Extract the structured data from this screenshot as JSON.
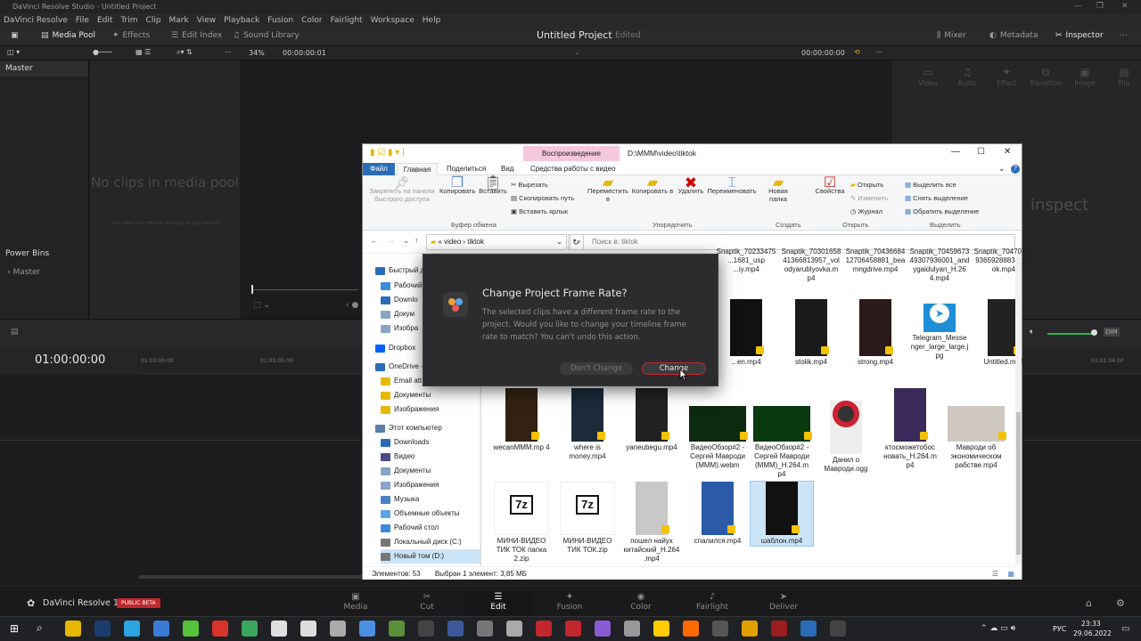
{
  "app": {
    "window_title": "DaVinci Resolve Studio - Untitled Project",
    "menu": [
      "DaVinci Resolve",
      "File",
      "Edit",
      "Trim",
      "Clip",
      "Mark",
      "View",
      "Playback",
      "Fusion",
      "Color",
      "Fairlight",
      "Workspace",
      "Help"
    ],
    "toolbar": {
      "media_pool": "Media Pool",
      "effects": "Effects",
      "edit_index": "Edit Index",
      "sound_library": "Sound Library",
      "project_title": "Untitled Project",
      "project_state": "Edited",
      "mixer": "Mixer",
      "metadata": "Metadata",
      "inspector": "Inspector"
    },
    "subbar": {
      "zoom": "34%",
      "timecode_left": "00:00:00:01",
      "timecode_right": "00:00:00:00"
    },
    "left_panel": {
      "master": "Master",
      "power_bins": "Power Bins",
      "power_master": "Master"
    },
    "media_pool": {
      "empty_text": "No clips in media pool",
      "hint": "Add clips from Media Storage to get started"
    },
    "inspector_panel": {
      "tabs": [
        "Video",
        "Audio",
        "Effect",
        "Transition",
        "Image",
        "File"
      ],
      "placeholder": "inspect"
    },
    "timeline": {
      "timecode": "01:00:00:00",
      "ruler": [
        "01:00:00:00",
        "01:00:05:00",
        "01:01:04:00"
      ]
    },
    "pages": [
      "Media",
      "Cut",
      "Edit",
      "Fusion",
      "Color",
      "Fairlight",
      "Deliver"
    ],
    "active_page": "Edit",
    "brand": "DaVinci Resolve 18",
    "beta_badge": "PUBLIC BETA"
  },
  "explorer": {
    "ribbon_context_tab": "Воспроизведение",
    "path_title": "D:\\MMM\\video\\tiktok",
    "tabs": [
      "Файл",
      "Главная",
      "Поделиться",
      "Вид",
      "Средства работы с видео"
    ],
    "ribbon": {
      "pin": "Закрепить на панели быстрого доступа",
      "copy": "Копировать",
      "paste": "Вставить",
      "cut": "Вырезать",
      "copy_path": "Скопировать путь",
      "paste_shortcut": "Вставить ярлык",
      "group_clipboard": "Буфер обмена",
      "move_to": "Переместить в",
      "copy_to": "Копировать в",
      "delete": "Удалить",
      "rename": "Переименовать",
      "group_organize": "Упорядочить",
      "new_folder": "Новая папка",
      "group_create": "Создать",
      "properties": "Свойства",
      "open": "Открыть",
      "edit": "Изменить",
      "history": "Журнал",
      "group_open": "Открыть",
      "select_all": "Выделить все",
      "select_none": "Снять выделение",
      "invert": "Обратить выделение",
      "group_select": "Выделить"
    },
    "address": {
      "parent": "«",
      "crumb1": "video",
      "crumb2": "tiktok",
      "search_placeholder": "Поиск в: tiktok"
    },
    "nav": [
      {
        "label": "Быстрый д",
        "icon": "star"
      },
      {
        "label": "Рабочий",
        "icon": "desktop"
      },
      {
        "label": "Downlo",
        "icon": "download"
      },
      {
        "label": "Докум",
        "icon": "doc"
      },
      {
        "label": "Изобра",
        "icon": "image"
      },
      {
        "label": "Dropbox",
        "icon": "dropbox"
      },
      {
        "label": "OneDrive -",
        "icon": "cloud"
      },
      {
        "label": "Email att",
        "icon": "folder"
      },
      {
        "label": "Документы",
        "icon": "folder"
      },
      {
        "label": "Изображения",
        "icon": "folder"
      },
      {
        "label": "Этот компьютер",
        "icon": "pc"
      },
      {
        "label": "Downloads",
        "icon": "download"
      },
      {
        "label": "Видео",
        "icon": "video"
      },
      {
        "label": "Документы",
        "icon": "doc"
      },
      {
        "label": "Изображения",
        "icon": "image"
      },
      {
        "label": "Музыка",
        "icon": "music"
      },
      {
        "label": "Объемные объекты",
        "icon": "3d"
      },
      {
        "label": "Рабочий стол",
        "icon": "desktop"
      },
      {
        "label": "Локальный диск (C:)",
        "icon": "drive"
      },
      {
        "label": "Новый том (D:)",
        "icon": "drive"
      }
    ],
    "files": [
      {
        "name": "Snaptik_70233475 ...1681_usp ...iy.mp4"
      },
      {
        "name": "Snaptik_70301658 41366813957_vol odyarublyovka.m p4"
      },
      {
        "name": "Snaptik_70436684 12706458881_bea mngdrive.mp4"
      },
      {
        "name": "Snaptik_70459673 49307936001_and ygaidulyan_H.26 4.mp4"
      },
      {
        "name": "Snaptik_70470787 93659288834_tikt ok.mp4"
      },
      {
        "name": "...en.mp4"
      },
      {
        "name": "stolik.mp4"
      },
      {
        "name": "strong.mp4"
      },
      {
        "name": "Telegram_Messe nger_large_large.j pg"
      },
      {
        "name": "Untitled.mp4"
      },
      {
        "name": "wecanMMM.mp 4"
      },
      {
        "name": "where is money.mp4"
      },
      {
        "name": "yaneubegu.mp4"
      },
      {
        "name": "ВидеоОбзор#2 - Сергей Мавроди (МММ).webm"
      },
      {
        "name": "ВидеоОбзор#2 - Сергей Мавроди (МММ)_H.264.m p4"
      },
      {
        "name": "Данил о Мавроди.ogg"
      },
      {
        "name": "ктосможетобос новать_H.264.m p4"
      },
      {
        "name": "Мавроди об экономическом рабстве.mp4"
      },
      {
        "name": "МИНИ-ВИДЕО ТИК ТОК папка 2.zip"
      },
      {
        "name": "МИНИ-ВИДЕО ТИК ТОК.zip"
      },
      {
        "name": "пошел найух китайский_H.264 .mp4"
      },
      {
        "name": "спалился.mp4"
      },
      {
        "name": "шаблон.mp4"
      }
    ],
    "status_count": "Элементов: 53",
    "status_selected": "Выбран 1 элемент: 3,85 МБ"
  },
  "dialog": {
    "title": "Change Project Frame Rate?",
    "body": "The selected clips have a different frame rate to the project. Would you like to change your timeline frame rate to match? You can't undo this action.",
    "dont_change": "Don't Change",
    "change": "Change"
  },
  "taskbar": {
    "lang": "РУС",
    "time": "23:33",
    "date": "29.06.2022"
  },
  "colors": {
    "accent_red": "#c1272d",
    "explorer_tab": "#2b6cb8",
    "context_tab": "#f6c8dd"
  }
}
